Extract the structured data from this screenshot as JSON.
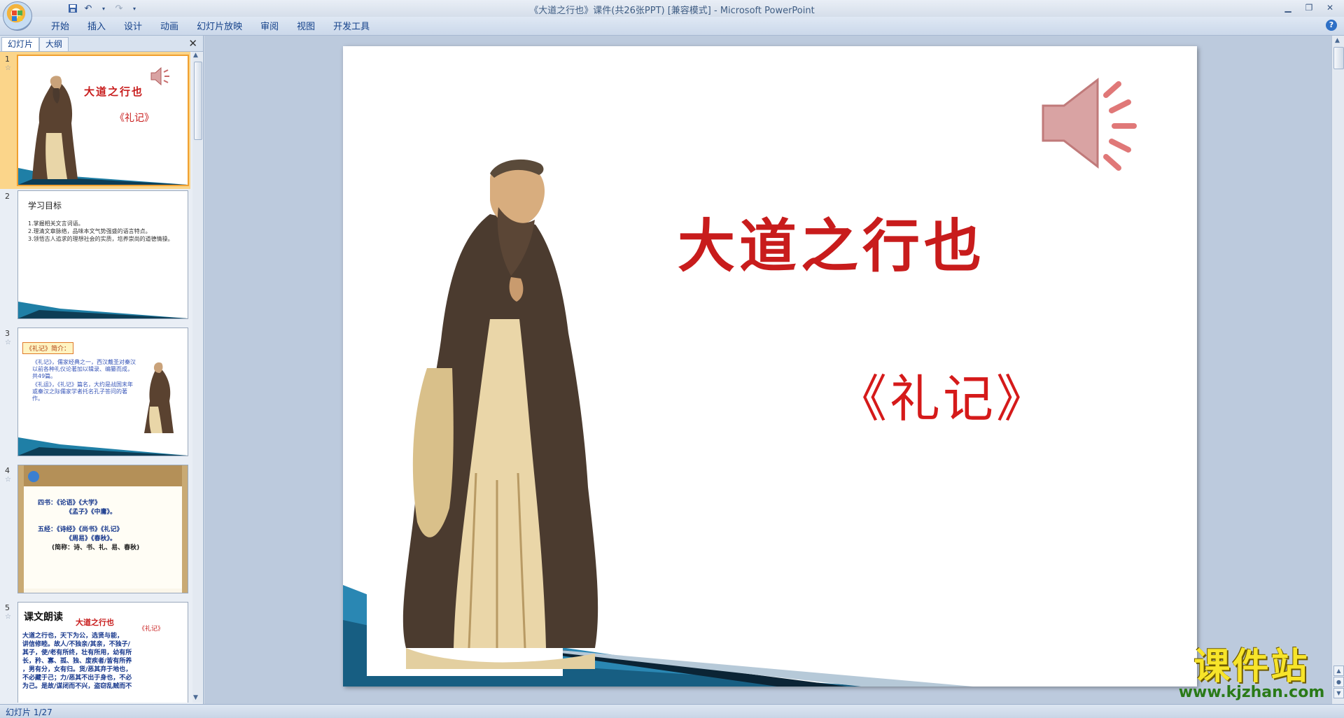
{
  "window": {
    "title": "《大道之行也》课件(共26张PPT) [兼容模式] - Microsoft PowerPoint"
  },
  "ribbon": {
    "tabs": [
      "开始",
      "插入",
      "设计",
      "动画",
      "幻灯片放映",
      "审阅",
      "视图",
      "开发工具"
    ]
  },
  "left_panel": {
    "tab_slides": "幻灯片",
    "tab_outline": "大纲",
    "thumbnails": [
      {
        "num": "1",
        "title": "大道之行也",
        "subtitle": "《礼记》"
      },
      {
        "num": "2",
        "heading": "学习目标",
        "lines": [
          "1.掌握相关文言词语。",
          "2.理清文章脉络，品味本文气势强盛的语言特点。",
          "3.领悟古人追求的理想社会的实质，培养崇尚的道德情操。"
        ]
      },
      {
        "num": "3",
        "label": "《礼记》简介：",
        "lines": [
          "《礼记》，儒家经典之一，西汉戴圣对秦汉以前各种礼仪论著加以辑录、编纂而成，共49篇。",
          "《礼运》，《礼记》篇名，大约是战国末年或秦汉之际儒家学者托名孔子答问的著作。"
        ]
      },
      {
        "num": "4",
        "lines": [
          "四书：《论语》《大学》",
          "《孟子》《中庸》。",
          "五经：《诗经》《尚书》《礼记》",
          "《周易》《春秋》。",
          "(简称：诗、书、礼、易、春秋)"
        ]
      },
      {
        "num": "5",
        "heading": "课文朗读",
        "title": "大道之行也",
        "subtitle": "《礼记》",
        "lines": [
          "大道之行也，天下为公，选贤与能，",
          "讲信修睦。故人/不独亲/其亲，不独子/",
          "其子，使/老有所终，壮有所用，幼有所",
          "长，矜、寡、孤、独、废疾者/皆有所养",
          "，男有分，女有归。货/恶其弃于地也，",
          "不必藏于己；力/恶其不出于身也，不必",
          "为己。是故/谋闭而不兴，盗窃乱贼而不"
        ]
      }
    ]
  },
  "slide": {
    "title": "大道之行也",
    "subtitle": "《礼记》",
    "speaker_icon": "speaker-icon"
  },
  "watermark": {
    "main": "课件站",
    "url": "www.kjzhan.com"
  },
  "status": {
    "slide_indicator": "幻灯片 1/27"
  },
  "colors": {
    "title_red": "#c81c1c",
    "ribbon_text": "#15428b",
    "watermark_yellow": "#f7e42a",
    "watermark_green": "#2a7a18"
  }
}
